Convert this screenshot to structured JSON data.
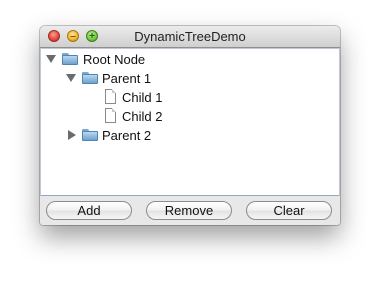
{
  "window": {
    "title": "DynamicTreeDemo",
    "controls": {
      "close_icon": "close-icon",
      "minimize_icon": "minimize-icon",
      "zoom_icon": "zoom-icon",
      "minimize_glyph": "–",
      "zoom_glyph": "+"
    }
  },
  "tree": {
    "nodes": [
      {
        "label": "Root Node",
        "type": "folder",
        "expanded": true,
        "level": 0
      },
      {
        "label": "Parent 1",
        "type": "folder",
        "expanded": true,
        "level": 1
      },
      {
        "label": "Child 1",
        "type": "leaf",
        "level": 2
      },
      {
        "label": "Child 2",
        "type": "leaf",
        "level": 2
      },
      {
        "label": "Parent 2",
        "type": "folder",
        "expanded": false,
        "level": 1
      }
    ]
  },
  "buttons": {
    "add_label": "Add",
    "remove_label": "Remove",
    "clear_label": "Clear"
  },
  "colors": {
    "folder_blue": "#6ea2cf",
    "tree_border_accent": "#8fa6c4",
    "close_red": "#e2463a",
    "minimize_yellow": "#f1b32b",
    "zoom_green": "#6fc73a"
  }
}
